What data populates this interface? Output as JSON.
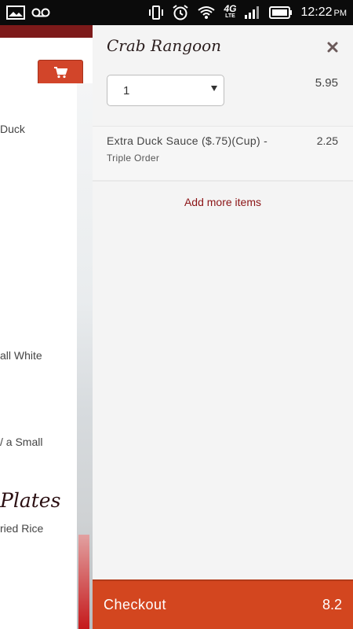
{
  "status_bar": {
    "time": "12:22",
    "ampm": "PM",
    "network_label": "4G",
    "network_sub": "LTE",
    "icons": [
      "gallery-icon",
      "voicemail-icon",
      "vibrate-icon",
      "alarm-icon",
      "wifi-icon",
      "signal-icon",
      "battery-icon"
    ]
  },
  "background_page": {
    "snippets": [
      "Duck",
      "all White",
      "/ a Small",
      "ried Rice"
    ],
    "heading": "Plates"
  },
  "cart": {
    "item_title": "Crab Rangoon",
    "quantity": "1",
    "item_price": "5.95",
    "addon": {
      "name": "Extra Duck Sauce ($.75)(Cup) -",
      "option": "Triple Order",
      "price": "2.25"
    },
    "add_more_label": "Add more items",
    "checkout_label": "Checkout",
    "checkout_total": "8.2"
  },
  "colors": {
    "accent": "#d3461f",
    "link": "#8b1416",
    "header_band": "#7d1a1a"
  }
}
